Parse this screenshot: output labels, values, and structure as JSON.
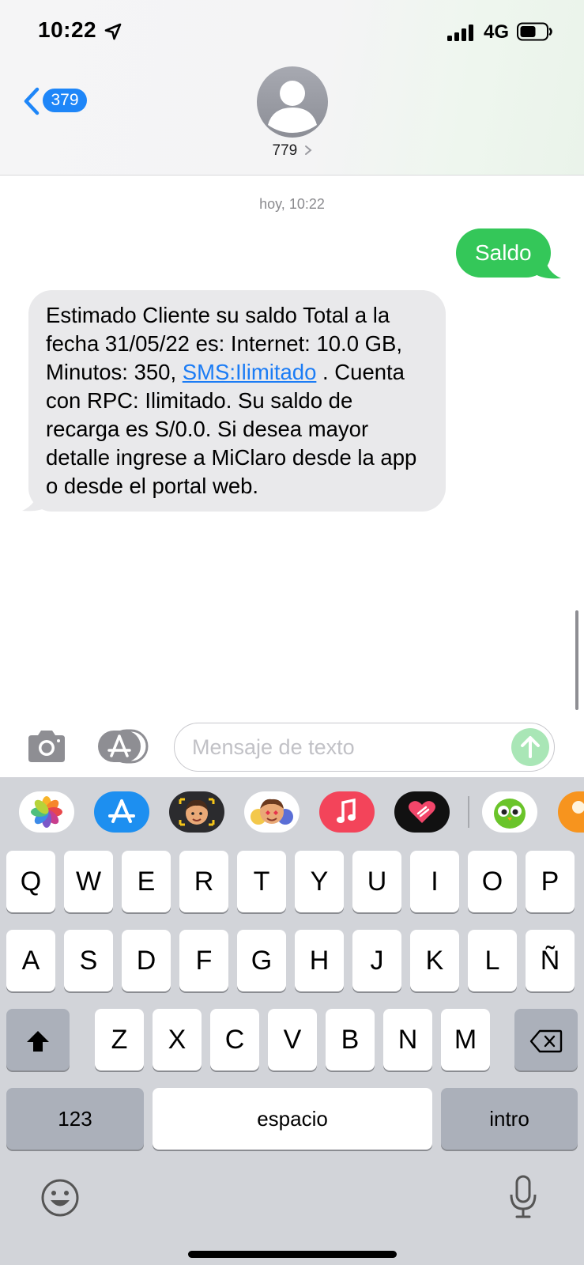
{
  "status_bar": {
    "time": "10:22",
    "network": "4G"
  },
  "header": {
    "back_count": "379",
    "contact_name": "779"
  },
  "conversation": {
    "timestamp": "hoy, 10:22",
    "sent_message": "Saldo",
    "received_message": {
      "text_before_link": "Estimado Cliente su saldo Total a la fecha 31/05/22 es: Internet: 10.0 GB, Minutos: 350, ",
      "link_text": "SMS:Ilimitado",
      "text_after_link": " . Cuenta con RPC: Ilimitado. Su saldo de recarga es S/0.0. Si desea mayor detalle ingrese a MiClaro desde la app o desde el portal web."
    }
  },
  "input_bar": {
    "placeholder": "Mensaje de texto"
  },
  "app_strip": [
    "photos-icon",
    "app-store-icon",
    "memoji-icon",
    "memoji-stickers-icon",
    "music-icon",
    "digital-touch-icon",
    "duolingo-icon",
    "partial-app-icon"
  ],
  "keyboard": {
    "row1": [
      "Q",
      "W",
      "E",
      "R",
      "T",
      "Y",
      "U",
      "I",
      "O",
      "P"
    ],
    "row2": [
      "A",
      "S",
      "D",
      "F",
      "G",
      "H",
      "J",
      "K",
      "L",
      "Ñ"
    ],
    "row3": [
      "Z",
      "X",
      "C",
      "V",
      "B",
      "N",
      "M"
    ],
    "numbers_key": "123",
    "space_key": "espacio",
    "return_key": "intro"
  },
  "colors": {
    "sent_bubble": "#34c759",
    "received_bubble": "#e9e9eb",
    "link": "#1b7cf5",
    "badge": "#1e86f8"
  }
}
